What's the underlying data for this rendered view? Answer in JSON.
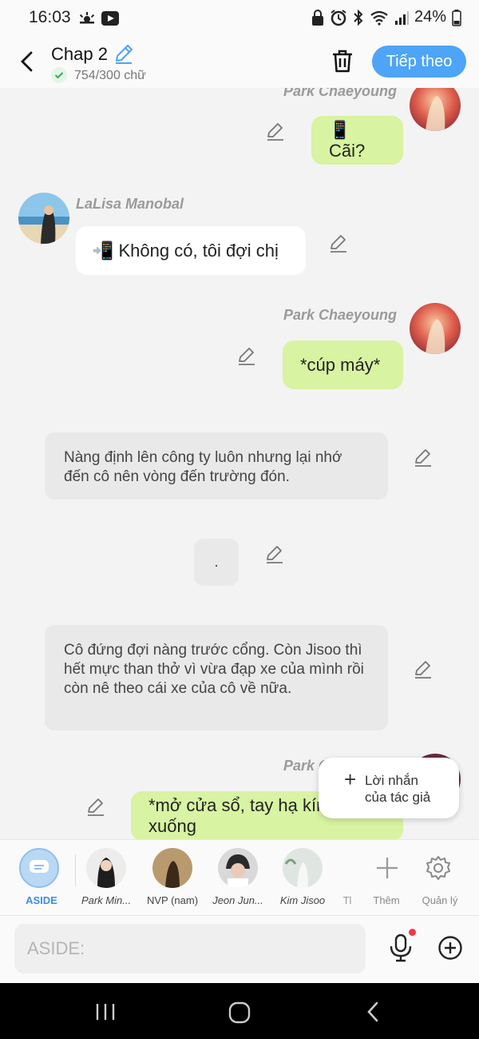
{
  "status_bar": {
    "time": "16:03",
    "battery": "24%"
  },
  "header": {
    "chapter_title": "Chap 2",
    "word_count": "754/300 chữ",
    "next_label": "Tiếp theo"
  },
  "messages": [
    {
      "speaker": "Park Chaeyoung",
      "text": "📱Cãi?"
    },
    {
      "speaker": "LaLisa Manobal",
      "text": "📲 Không có, tôi đợi chị"
    },
    {
      "speaker": "Park Chaeyoung",
      "text": "*cúp máy*"
    },
    {
      "narration": "Nàng định lên công ty luôn nhưng lại nhớ đến cô nên vòng đến trường đón."
    },
    {
      "narration": "."
    },
    {
      "narration": "Cô đứng đợi nàng trước cổng. Còn Jisoo thì hết mực than thở vì vừa đạp xe của mình rồi còn nê theo cái xe của cô về nữa."
    },
    {
      "speaker": "Park C",
      "text": "*mở cửa sổ, tay hạ kính xuống"
    }
  ],
  "author_note": {
    "icon": "+",
    "label_line1": "Lời nhắn",
    "label_line2": "của tác giả"
  },
  "characters": [
    {
      "label": "ASIDE",
      "icon": "chat-bubble-icon"
    },
    {
      "label": "Park Min..."
    },
    {
      "label": "NVP (nam)"
    },
    {
      "label": "Jeon Jun..."
    },
    {
      "label": "Kim Jisoo"
    },
    {
      "label": "Tl"
    }
  ],
  "actions": {
    "add_label": "Thêm",
    "manage_label": "Quản lý"
  },
  "input": {
    "placeholder": "ASIDE:"
  },
  "colors": {
    "accent": "#4ea4f6",
    "green_bubble": "#d8f3a2",
    "aside_active": "#b9d8f4",
    "record_dot": "#f0384a"
  }
}
